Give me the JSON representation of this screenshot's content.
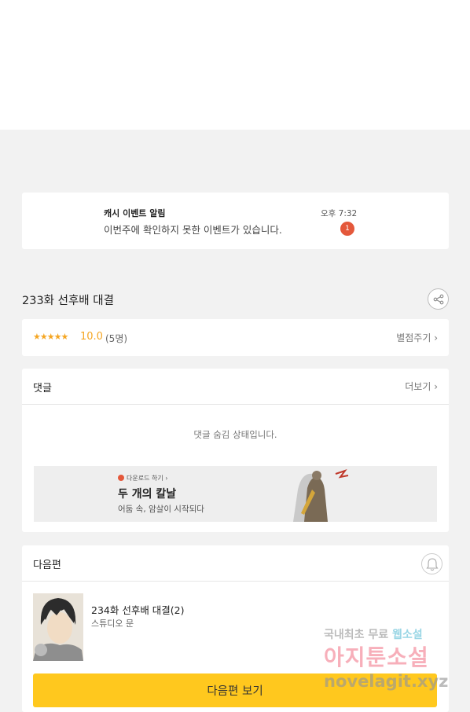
{
  "notice": {
    "title": "캐시 이벤트 알림",
    "message": "이번주에 확인하지 못한 이벤트가 있습니다.",
    "time": "오후 7:32",
    "badge": "1"
  },
  "episode": {
    "title": "233화 선후배 대결"
  },
  "rating": {
    "stars": "★★★★★",
    "score": "10.0",
    "count": "(5명)",
    "rate_link": "별점주기 ›"
  },
  "comments": {
    "heading": "댓글",
    "more": "더보기 ›",
    "hidden_message": "댓글 숨김 상태입니다."
  },
  "ad": {
    "small_label": "다운로드 하기 ›",
    "title": "두 개의 칼날",
    "subtitle": "어둠 속, 암살이 시작되다"
  },
  "next": {
    "heading": "다음편",
    "episode_title": "234화 선후배 대결(2)",
    "author": "스튜디오 문",
    "button_label": "다음편 보기"
  },
  "watermark": {
    "line1a": "국내최초 무료",
    "line1b": "웹소설",
    "line2": "아지툰소설",
    "line3": "novelagit.xyz"
  },
  "colors": {
    "accent_yellow": "#ffc81e",
    "star_orange": "#f5a623",
    "badge_red": "#e4583b"
  }
}
